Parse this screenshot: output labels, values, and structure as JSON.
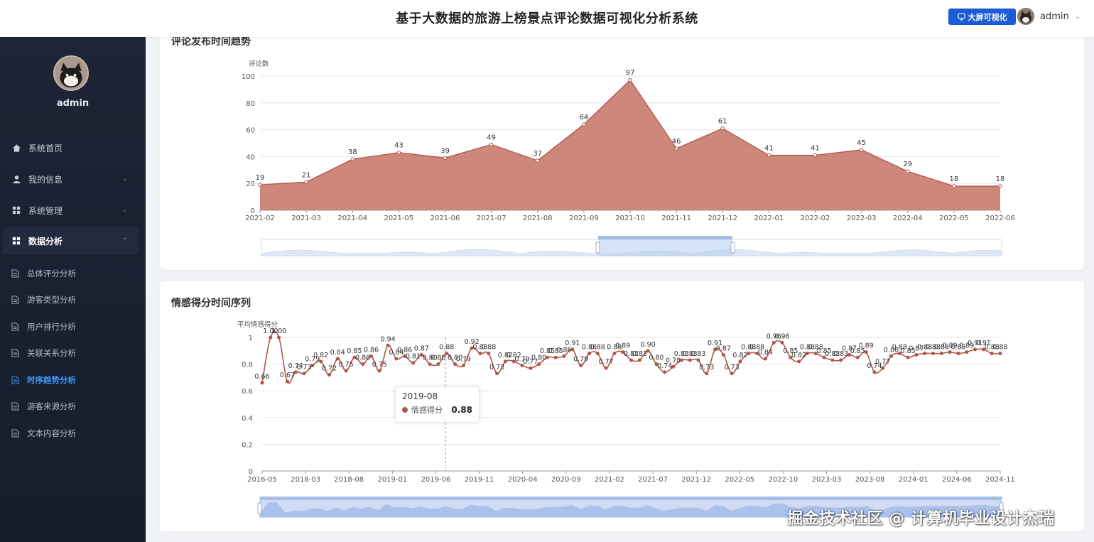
{
  "header": {
    "title": "基于大数据的旅游上榜景点评论数据可视化分析系统",
    "bigscreen_label": "大屏可视化",
    "user_name": "admin"
  },
  "sidebar": {
    "user_name": "admin",
    "menu": [
      {
        "label": "系统首页",
        "icon": "home-icon"
      },
      {
        "label": "我的信息",
        "icon": "user-icon"
      },
      {
        "label": "系统管理",
        "icon": "grid-icon"
      },
      {
        "label": "数据分析",
        "icon": "grid-icon"
      }
    ],
    "sub_menu": [
      {
        "label": "总体评分分析"
      },
      {
        "label": "游客类型分析"
      },
      {
        "label": "用户排行分析"
      },
      {
        "label": "关联关系分析"
      },
      {
        "label": "时序趋势分析",
        "active": true
      },
      {
        "label": "游客来源分析"
      },
      {
        "label": "文本内容分析"
      }
    ]
  },
  "chart1_title": "评论发布时间趋势",
  "chart2_title": "情感得分时间序列",
  "tooltip": {
    "date": "2019-08",
    "series": "情感得分",
    "value": "0.88"
  },
  "watermark": "掘金技术社区 @ 计算机毕业设计杰瑞",
  "colors": {
    "series": "#b0564a",
    "area": "#c97a6d",
    "accent": "#409eff",
    "button": "#1e5bd6"
  },
  "chart_data": [
    {
      "type": "area",
      "title": "评论发布时间趋势",
      "ylabel": "评论数",
      "ylim": [
        0,
        100
      ],
      "yticks": [
        0,
        20,
        40,
        60,
        80,
        100
      ],
      "categories": [
        "2021-02",
        "2021-03",
        "2021-04",
        "2021-05",
        "2021-06",
        "2021-07",
        "2021-08",
        "2021-09",
        "2021-10",
        "2021-11",
        "2021-12",
        "2022-01",
        "2022-02",
        "2022-03",
        "2022-04",
        "2022-05",
        "2022-06"
      ],
      "values": [
        19,
        21,
        38,
        43,
        39,
        49,
        37,
        64,
        97,
        46,
        61,
        41,
        41,
        45,
        29,
        18,
        18
      ],
      "grid": true,
      "data_zoom": "bottom"
    },
    {
      "type": "line",
      "title": "情感得分时间序列",
      "ylabel": "平均情感得分",
      "ylim": [
        0,
        1
      ],
      "yticks": [
        0,
        0.2,
        0.4,
        0.6,
        0.8,
        1
      ],
      "x_tick_labels": [
        "2016-05",
        "2018-03",
        "2018-08",
        "2019-01",
        "2019-06",
        "2019-11",
        "2020-04",
        "2020-09",
        "2021-02",
        "2021-07",
        "2021-12",
        "2022-05",
        "2022-10",
        "2023-03",
        "2023-08",
        "2024-01",
        "2024-06",
        "2024-11"
      ],
      "values": [
        0.66,
        1.0,
        1.0,
        0.67,
        0.74,
        0.73,
        0.79,
        0.82,
        0.72,
        0.84,
        0.75,
        0.85,
        0.8,
        0.86,
        0.75,
        0.94,
        0.84,
        0.86,
        0.81,
        0.87,
        0.8,
        0.8,
        0.88,
        0.8,
        0.79,
        0.92,
        0.88,
        0.88,
        0.73,
        0.82,
        0.82,
        0.79,
        0.77,
        0.8,
        0.85,
        0.85,
        0.86,
        0.91,
        0.79,
        0.88,
        0.88,
        0.77,
        0.88,
        0.89,
        0.83,
        0.83,
        0.9,
        0.8,
        0.74,
        0.78,
        0.83,
        0.83,
        0.83,
        0.73,
        0.91,
        0.87,
        0.73,
        0.82,
        0.88,
        0.88,
        0.84,
        0.96,
        0.96,
        0.85,
        0.82,
        0.88,
        0.88,
        0.85,
        0.83,
        0.83,
        0.87,
        0.85,
        0.89,
        0.74,
        0.77,
        0.86,
        0.88,
        0.85,
        0.87,
        0.88,
        0.88,
        0.88,
        0.89,
        0.88,
        0.89,
        0.91,
        0.91,
        0.88,
        0.88
      ],
      "grid": true,
      "data_zoom": "bottom"
    }
  ]
}
